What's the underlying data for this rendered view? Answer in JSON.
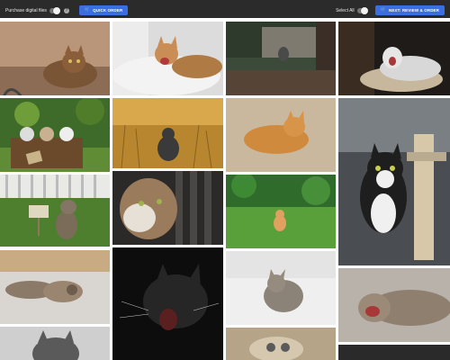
{
  "toolbar": {
    "purchase_digital_label": "Purchase digital files",
    "quick_order_label": "QUICK ORDER",
    "select_all_label": "Select All",
    "next_review_label": "NEXT: REVIEW & ORDER"
  },
  "colors": {
    "toolbar_bg": "#2b2b2b",
    "accent": "#3b6ee0"
  },
  "gallery": {
    "photos": [
      {
        "name": "cat-on-sand"
      },
      {
        "name": "cat-yawning-bed"
      },
      {
        "name": "cat-stone-wall"
      },
      {
        "name": "cat-yawning-dark"
      },
      {
        "name": "kittens-in-basket"
      },
      {
        "name": "cat-in-grass-sunset"
      },
      {
        "name": "orange-cat-lying"
      },
      {
        "name": "black-white-cat-on-tree"
      },
      {
        "name": "tabby-cat-with-sign"
      },
      {
        "name": "cat-closeup-fence"
      },
      {
        "name": "kitten-in-field"
      },
      {
        "name": "cats-on-blanket"
      },
      {
        "name": "black-cat-yawning"
      },
      {
        "name": "kitten-on-white"
      },
      {
        "name": "cat-yawning-lying"
      },
      {
        "name": "cat-bottom-left"
      },
      {
        "name": "cat-bottom-center"
      },
      {
        "name": "cat-bottom-right"
      }
    ]
  }
}
